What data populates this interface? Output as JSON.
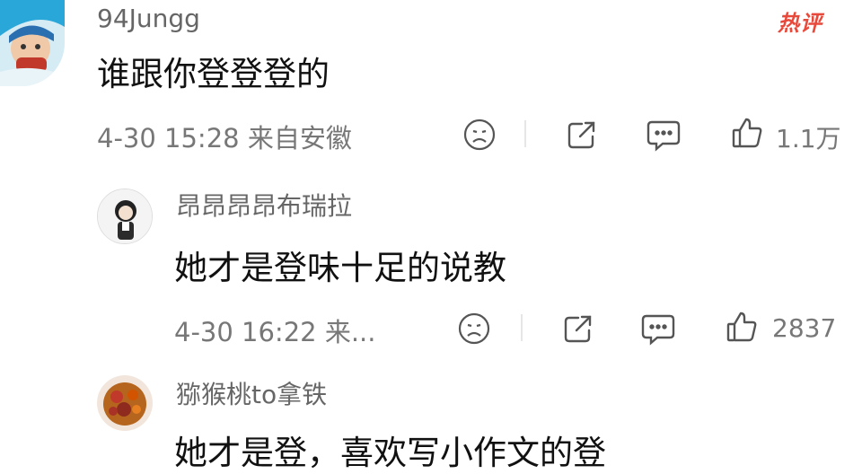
{
  "comments": [
    {
      "username": "94Jungg",
      "badge": "热评",
      "content": "谁跟你登登登的",
      "meta": "4-30 15:28 来自安徽",
      "likes": "1.1万"
    },
    {
      "username": "昂昂昂昂布瑞拉",
      "content": "她才是登味十足的说教",
      "meta": "4-30 16:22 来...",
      "likes": "2837"
    },
    {
      "username": "猕猴桃to拿铁",
      "content": "她才是登，喜欢写小作文的登"
    }
  ],
  "icons": {
    "emoji": "sad-face-icon",
    "share": "share-icon",
    "comment": "comment-icon",
    "like": "thumbs-up-icon"
  },
  "colors": {
    "badge": "#e8493b",
    "text": "#111111",
    "meta": "#777777",
    "icon": "#555555"
  }
}
